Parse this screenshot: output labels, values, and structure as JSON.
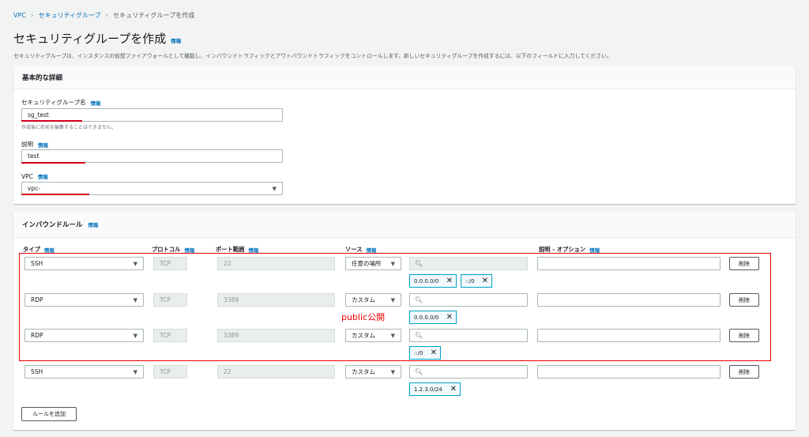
{
  "breadcrumb": [
    "VPC",
    "セキュリティグループ",
    "セキュリティグループを作成"
  ],
  "page": {
    "title": "セキュリティグループを作成",
    "info": "情報",
    "description": "セキュリティグループは、インスタンスの仮想ファイアウォールとして機能し、インバウンドトラフィックとアウトバウンドトラフィックをコントロールします。新しいセキュリティグループを作成するには、以下のフィールドに入力してください。"
  },
  "basic": {
    "header": "基本的な詳細",
    "name_label": "セキュリティグループ名",
    "name_value": "sg_test",
    "name_hint": "作成後に名前を編集することはできません。",
    "desc_label": "説明",
    "desc_value": "test",
    "vpc_label": "VPC",
    "vpc_value": "vpc-"
  },
  "inbound": {
    "header": "インバウンドルール",
    "columns": {
      "type": "タイプ",
      "protocol": "プロトコル",
      "port": "ポート範囲",
      "source": "ソース",
      "description": "説明 - オプション"
    },
    "rules": [
      {
        "type": "SSH",
        "protocol": "TCP",
        "port": "22",
        "source": "任意の場所",
        "tags": [
          "0.0.0.0/0",
          "::/0"
        ]
      },
      {
        "type": "RDP",
        "protocol": "TCP",
        "port": "3389",
        "source": "カスタム",
        "tags": [
          "0.0.0.0/0"
        ]
      },
      {
        "type": "RDP",
        "protocol": "TCP",
        "port": "3389",
        "source": "カスタム",
        "tags": [
          "::/0"
        ]
      },
      {
        "type": "SSH",
        "protocol": "TCP",
        "port": "22",
        "source": "カスタム",
        "tags": [
          "1.2.3.0/24"
        ]
      }
    ],
    "delete_label": "削除",
    "add_rule_label": "ルールを追加",
    "annotation": "public公開"
  },
  "colors": {
    "link": "#0073bb",
    "annotation": "#e00000",
    "tag_border": "#00a1c9"
  }
}
